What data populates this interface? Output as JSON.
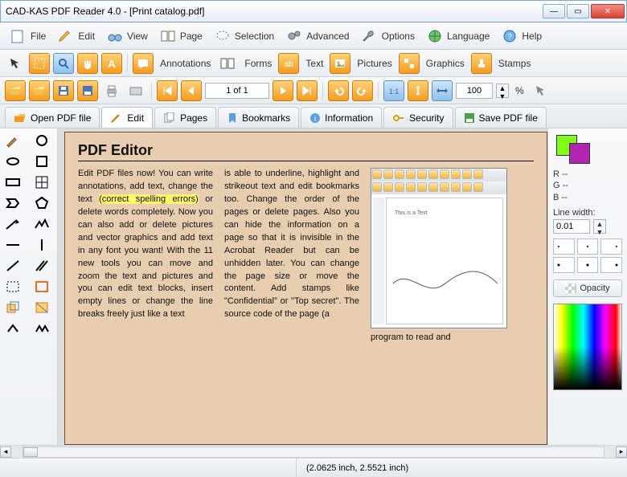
{
  "window": {
    "title": "CAD-KAS PDF Reader 4.0 - [Print catalog.pdf]"
  },
  "menu": {
    "file": "File",
    "edit": "Edit",
    "view": "View",
    "page": "Page",
    "selection": "Selection",
    "advanced": "Advanced",
    "options": "Options",
    "language": "Language",
    "help": "Help"
  },
  "toolbar": {
    "annotations": "Annotations",
    "forms": "Forms",
    "text": "Text",
    "pictures": "Pictures",
    "graphics": "Graphics",
    "stamps": "Stamps",
    "page_indicator": "1 of 1",
    "zoom_value": "100",
    "zoom_pct": "%"
  },
  "tabs": {
    "open": "Open PDF file",
    "edit": "Edit",
    "pages": "Pages",
    "bookmarks": "Bookmarks",
    "information": "Information",
    "security": "Security",
    "save": "Save PDF file"
  },
  "doc": {
    "heading": "PDF Editor",
    "col1a": "Edit PDF files now! You can write annotations, add text, change the text ",
    "col1_hl": "(correct spelling errors)",
    "col1b": " or delete words completely. Now you can also add or delete pictures and vector graphics and add text in any font you want! With the 11 new tools you can move and zoom the text and pictures and you can edit text blocks, insert empty lines or change the line breaks freely just like a text",
    "col2": "is able to underline, highlight and strikeout text and edit bookmarks too. Change the order of the pages or delete pages. Also you can hide the information on a page so that it is invisible in the Acrobat Reader but can be unhidden later. You can change the page size or move the content. Add stamps like \"Confidential\" or \"Top secret\". The source code of the page (a",
    "col3": "program to read and",
    "emb_text": "This is a Text"
  },
  "right": {
    "r": "R --",
    "g": "G --",
    "b": "B --",
    "linewidth_label": "Line width:",
    "linewidth_value": "0.01",
    "opacity": "Opacity"
  },
  "status": {
    "coords": "(2.0625 inch, 2.5521 inch)"
  }
}
